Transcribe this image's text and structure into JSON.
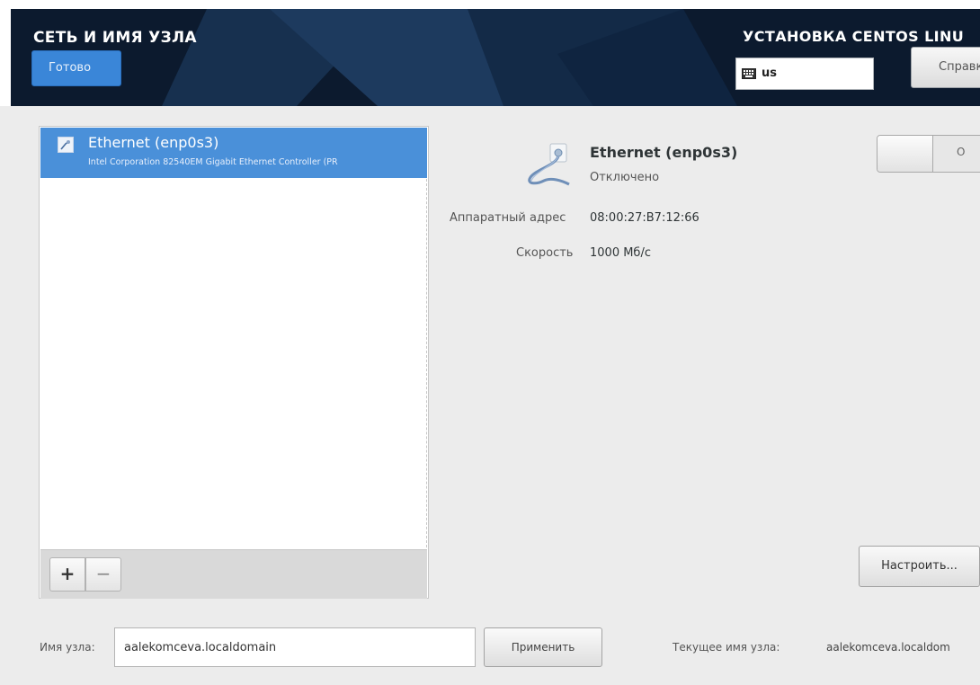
{
  "header": {
    "page_title": "СЕТЬ И ИМЯ УЗЛА",
    "done_label": "Готово",
    "install_title": "УСТАНОВКА CENTOS LINU",
    "keyboard_layout": "us",
    "help_label": "Справк"
  },
  "network_list": {
    "items": [
      {
        "name": "Ethernet (enp0s3)",
        "description": "Intel Corporation 82540EM Gigabit Ethernet Controller (PR",
        "selected": true
      }
    ],
    "add_label": "+",
    "remove_label": "−"
  },
  "details": {
    "name": "Ethernet (enp0s3)",
    "status": "Отключено",
    "toggle_state_label": "O",
    "toggle_on": false,
    "hw_address_label": "Аппаратный адрес",
    "hw_address_value": "08:00:27:B7:12:66",
    "speed_label": "Скорость",
    "speed_value": "1000 Мб/с",
    "configure_label": "Настроить..."
  },
  "hostname": {
    "label": "Имя узла:",
    "value": "aalekomceva.localdomain",
    "apply_label": "Применить",
    "current_label": "Текущее имя узла:",
    "current_value": "aalekomceva.localdom"
  },
  "colors": {
    "header_bg": "#0c1a2e",
    "accent": "#3a86d8",
    "selection": "#4a90d9",
    "page_bg": "#ececec"
  }
}
